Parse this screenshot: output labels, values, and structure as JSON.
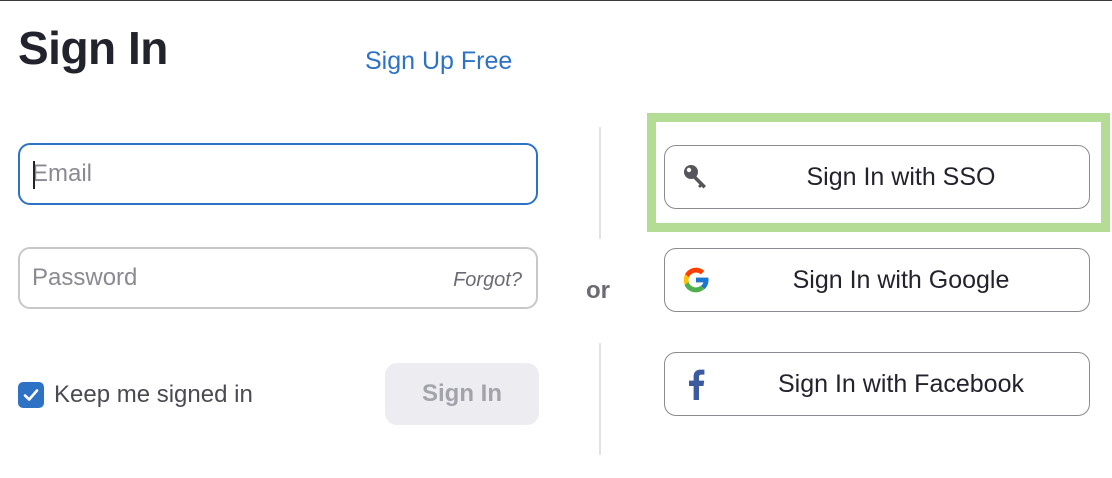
{
  "header": {
    "title": "Sign In",
    "signup_link": "Sign Up Free"
  },
  "form": {
    "email": {
      "placeholder": "Email",
      "value": ""
    },
    "password": {
      "placeholder": "Password",
      "value": "",
      "forgot_label": "Forgot?"
    },
    "remember": {
      "label": "Keep me signed in",
      "checked": true
    },
    "submit_label": "Sign In"
  },
  "separator": {
    "label": "or"
  },
  "social": {
    "sso": {
      "label": "Sign In with SSO",
      "icon": "key-icon"
    },
    "google": {
      "label": "Sign In with Google",
      "icon": "google-icon"
    },
    "facebook": {
      "label": "Sign In with Facebook",
      "icon": "facebook-icon"
    }
  },
  "colors": {
    "accent": "#2d72c4",
    "highlight": "#b4dc94",
    "title": "#23232d",
    "disabled_button_bg": "#ededf1"
  }
}
